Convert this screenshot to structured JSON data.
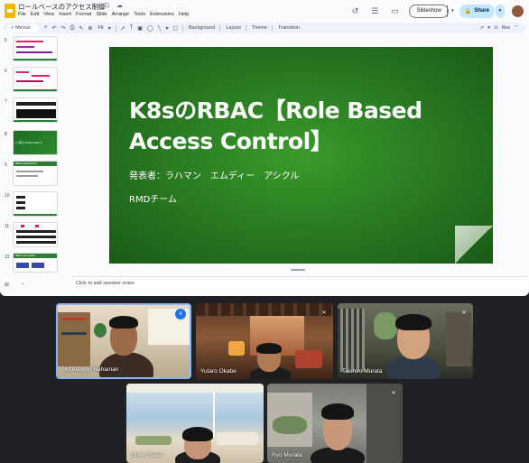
{
  "window": {
    "doc_title": "ロールベースのアクセス制御",
    "title_icons": "☆ ⊡ ☁",
    "menu": [
      "File",
      "Edit",
      "View",
      "Insert",
      "Format",
      "Slide",
      "Arrange",
      "Tools",
      "Extensions",
      "Help"
    ],
    "slideshow_label": "Slideshow",
    "share_label": "Share"
  },
  "toolbar": {
    "search_label": "Menus",
    "zoom": "Fit",
    "background_label": "Background",
    "layout_label": "Layout",
    "theme_label": "Theme",
    "transition_label": "Transition",
    "rec_label": "Rec"
  },
  "filmstrip": {
    "numbers": [
      "5",
      "6",
      "7",
      "8",
      "9",
      "10",
      "11",
      "12"
    ],
    "thumb8_text": "2. 認可 (Authorization)",
    "thumb9_text": "RBAC (Authorization)",
    "thumb12_text": "RBAC Authorization..."
  },
  "slide": {
    "title_line1": "K8sのRBAC【Role Based",
    "title_line2": "Access Control】",
    "presenter": "発表者：ラハマン　エムディー　アシクル",
    "team": "RMDチーム"
  },
  "notes": {
    "placeholder": "Click to add speaker notes"
  },
  "participants": [
    {
      "name": "Md Ashiqur Rahaman",
      "speaking": true
    },
    {
      "name": "Yutaro Okabe",
      "speaking": false
    },
    {
      "name": "Taishiro Murata",
      "speaking": false
    },
    {
      "name": "Ginko Sakai",
      "speaking": false
    },
    {
      "name": "Ryo Murata",
      "speaking": false
    }
  ],
  "colors": {
    "slide_green": "#2b7d22",
    "share_blue": "#c2e7ff",
    "speaking_blue": "#1a73e8"
  }
}
